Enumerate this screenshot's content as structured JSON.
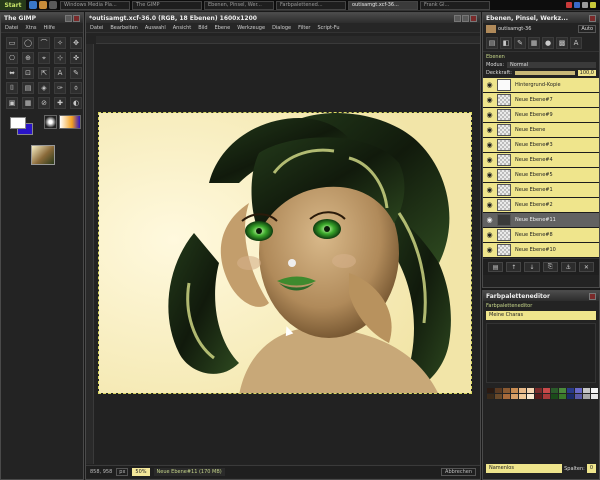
{
  "taskbar": {
    "start_label": "Start",
    "buttons": [
      "Windows Media Pla...",
      "The GIMP",
      "Ebenen, Pinsel, Wer...",
      "Farbpalettened...",
      "outisamgt.xcf-36...",
      "Frank Gl..."
    ],
    "active_index": 4
  },
  "toolbox": {
    "title": "The GIMP",
    "menu": [
      "Datei",
      "Xtns",
      "Hilfe"
    ],
    "tools": [
      "▭",
      "◯",
      "⌒",
      "✧",
      "✥",
      "✂",
      "⎔",
      "⊕",
      "⌖",
      "⊹",
      "✜",
      "⤡",
      "⬌",
      "⊡",
      "⇱",
      "A",
      "✎",
      "⊘",
      "⌷",
      "▤",
      "◈",
      "✑",
      "⌽",
      "⊙",
      "▣",
      "▦",
      "⊘",
      "✚",
      "◐",
      "❖"
    ],
    "fg_color": "#ffffff",
    "bg_color": "#2a14c8"
  },
  "image_window": {
    "title": "*outisamgt.xcf-36.0 (RGB, 18 Ebenen) 1600x1200",
    "menu": [
      "Datei",
      "Bearbeiten",
      "Auswahl",
      "Ansicht",
      "Bild",
      "Ebene",
      "Werkzeuge",
      "Dialoge",
      "Filter",
      "Script-Fu"
    ],
    "status": {
      "coords": "858, 958",
      "unit": "px",
      "zoom": "50%",
      "info": "Neue Ebene#11 (170 MB)",
      "cancel": "Abbrechen"
    }
  },
  "layers_dock": {
    "title": "Ebenen, Pinsel, Werkz...",
    "image_select": "outisamgt-36",
    "tab_label": "Ebenen",
    "mode_label": "Modus:",
    "mode_value": "Normal",
    "opacity_label": "Deckkraft:",
    "opacity_value": "100,0",
    "layers": [
      {
        "name": "Hintergrund-Kopie",
        "thumb": "white",
        "selected": false
      },
      {
        "name": "Neue Ebene#7",
        "thumb": "checker",
        "selected": false
      },
      {
        "name": "Neue Ebene#9",
        "thumb": "checker",
        "selected": false
      },
      {
        "name": "Neue Ebene",
        "thumb": "checker",
        "selected": false
      },
      {
        "name": "Neue Ebene#3",
        "thumb": "checker",
        "selected": false
      },
      {
        "name": "Neue Ebene#4",
        "thumb": "checker",
        "selected": false
      },
      {
        "name": "Neue Ebene#5",
        "thumb": "checker",
        "selected": false
      },
      {
        "name": "Neue Ebene#1",
        "thumb": "checker",
        "selected": false
      },
      {
        "name": "Neue Ebene#2",
        "thumb": "checker",
        "selected": false
      },
      {
        "name": "Neue Ebene#11",
        "thumb": "dark",
        "selected": true
      },
      {
        "name": "Neue Ebene#8",
        "thumb": "checker",
        "selected": false
      },
      {
        "name": "Neue Ebene#10",
        "thumb": "checker",
        "selected": false
      }
    ],
    "buttons": [
      "▤",
      "↑",
      "↓",
      "⎘",
      "⚓",
      "✕"
    ]
  },
  "palette_dock": {
    "title": "Farbpaletteneditor",
    "tab_label": "Farbpaletteneditor",
    "palette_name": "Meine Charas",
    "swatches": [
      "#2a1a12",
      "#5a3a22",
      "#8a5a32",
      "#c88c52",
      "#e8b888",
      "#f4d4b0",
      "#7a2a2a",
      "#c84a4a",
      "#2a5a2a",
      "#4a8a3a",
      "#2a3a8a",
      "#6a6ac8",
      "#c8c8c8",
      "#f4f4f4",
      "#3a2a1a",
      "#6a4a2a",
      "#a86a3a",
      "#d8a068",
      "#f0c898",
      "#fae8d0",
      "#5a1a1a",
      "#a83a3a",
      "#1a4a1a",
      "#3a7a2a",
      "#1a2a6a",
      "#5a5aa8",
      "#a8a8a8",
      "#e8e8e8"
    ],
    "name_field": "Namenlos",
    "columns_label": "Spalten:",
    "columns_value": "0"
  }
}
